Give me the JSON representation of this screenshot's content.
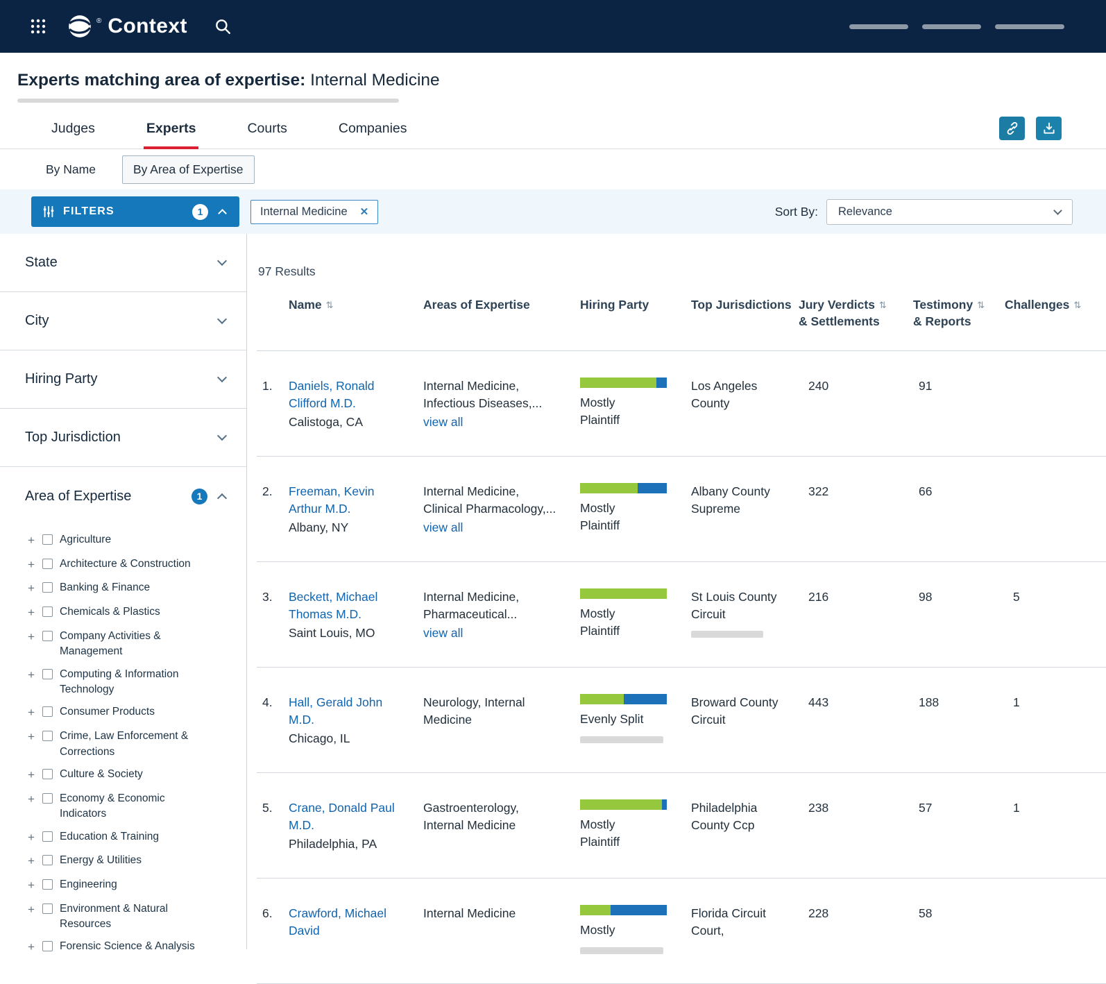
{
  "icons": {
    "sort_glyph": "⇅",
    "close_glyph": "✕",
    "plus_glyph": "+"
  },
  "header": {
    "logo_text": "Context",
    "registered": "®"
  },
  "page": {
    "title_bold": "Experts matching area of expertise:",
    "title_regular": " Internal Medicine"
  },
  "tabs": {
    "items": [
      {
        "label": "Judges"
      },
      {
        "label": "Experts",
        "active": true
      },
      {
        "label": "Courts"
      },
      {
        "label": "Companies"
      }
    ]
  },
  "subtabs": {
    "items": [
      {
        "label": "By Name"
      },
      {
        "label": "By Area of Expertise",
        "active": true
      }
    ]
  },
  "filter_bar": {
    "filters_label": "FILTERS",
    "filters_count": "1",
    "chips": [
      {
        "label": "Internal Medicine"
      }
    ],
    "sort_label": "Sort By:",
    "sort_value": "Relevance"
  },
  "sidebar": {
    "sections": [
      {
        "label": "State"
      },
      {
        "label": "City"
      },
      {
        "label": "Hiring Party"
      },
      {
        "label": "Top Jurisdiction"
      },
      {
        "label": "Area of Expertise",
        "count": "1",
        "expanded": true
      }
    ],
    "expertise_items": [
      {
        "label": "Agriculture"
      },
      {
        "label": "Architecture & Construction"
      },
      {
        "label": "Banking & Finance"
      },
      {
        "label": "Chemicals & Plastics"
      },
      {
        "label": "Company Activities & Management"
      },
      {
        "label": "Computing & Information Technology"
      },
      {
        "label": "Consumer Products"
      },
      {
        "label": "Crime, Law Enforcement & Corrections"
      },
      {
        "label": "Culture & Society"
      },
      {
        "label": "Economy & Economic Indicators"
      },
      {
        "label": "Education & Training"
      },
      {
        "label": "Energy & Utilities"
      },
      {
        "label": "Engineering"
      },
      {
        "label": "Environment & Natural Resources"
      },
      {
        "label": "Forensic Science & Analysis"
      }
    ]
  },
  "results": {
    "count_text": "97 Results",
    "columns": [
      {
        "label": "Name",
        "sortable": true
      },
      {
        "label": "Areas of Expertise"
      },
      {
        "label": "Hiring Party"
      },
      {
        "label": "Top Jurisdictions"
      },
      {
        "label": "Jury Verdicts",
        "label2": "& Settlements",
        "sortable": true
      },
      {
        "label": "Testimony",
        "label2": "& Reports",
        "sortable": true
      },
      {
        "label": "Challenges",
        "sortable": true
      }
    ],
    "rows": [
      {
        "rank": "1.",
        "name": "Daniels, Ronald Clifford M.D.",
        "location": "Calistoga, CA",
        "expertise": "Internal Medicine, Infectious Diseases,...",
        "view_all": "view all",
        "hiring": {
          "label": "Mostly Plaintiff",
          "green_style": "width:88%"
        },
        "jurisdiction": "Los Angeles County",
        "verdicts": "240",
        "testimony": "91",
        "challenges": ""
      },
      {
        "rank": "2.",
        "name": "Freeman, Kevin Arthur M.D.",
        "location": "Albany, NY",
        "expertise": "Internal Medicine, Clinical Pharmacology,...",
        "view_all": "view all",
        "hiring": {
          "label": "Mostly Plaintiff",
          "green_style": "width:66%"
        },
        "jurisdiction": "Albany County Supreme",
        "verdicts": "322",
        "testimony": "66",
        "challenges": ""
      },
      {
        "rank": "3.",
        "name": "Beckett, Michael Thomas M.D.",
        "location": "Saint Louis, MO",
        "expertise": "Internal Medicine, Pharmaceutical...",
        "view_all": "view all",
        "hiring": {
          "label": "Mostly Plaintiff",
          "green_style": "width:100%"
        },
        "jurisdiction": "St Louis County Circuit",
        "jur_ph_style": "display:block",
        "verdicts": "216",
        "testimony": "98",
        "challenges": "5"
      },
      {
        "rank": "4.",
        "name": "Hall, Gerald John M.D.",
        "location": "Chicago, IL",
        "expertise": "Neurology, Internal Medicine",
        "view_all": "",
        "hiring": {
          "label": "Evenly Split",
          "green_style": "width:50%",
          "ph_style": "display:block"
        },
        "jurisdiction": "Broward County Circuit",
        "verdicts": "443",
        "testimony": "188",
        "challenges": "1"
      },
      {
        "rank": "5.",
        "name": "Crane, Donald Paul M.D.",
        "location": "Philadelphia, PA",
        "expertise": "Gastroenterology, Internal Medicine",
        "view_all": "",
        "hiring": {
          "label": "Mostly Plaintiff",
          "green_style": "width:94%"
        },
        "jurisdiction": "Philadelphia County Ccp",
        "verdicts": "238",
        "testimony": "57",
        "challenges": "1"
      },
      {
        "rank": "6.",
        "name": "Crawford, Michael David",
        "location": "",
        "expertise": "Internal Medicine",
        "view_all": "",
        "hiring": {
          "label": "Mostly",
          "green_style": "width:35%",
          "ph_style": "display:block"
        },
        "jurisdiction": "Florida Circuit Court,",
        "verdicts": "228",
        "testimony": "58",
        "challenges": ""
      }
    ]
  },
  "colors": {
    "header_navy": "#0c2444",
    "accent_red": "#da2032",
    "primary_blue": "#1478bb",
    "plaintiff_green": "#96c83e",
    "defense_blue": "#1d71b8",
    "link_blue": "#1064b0"
  }
}
